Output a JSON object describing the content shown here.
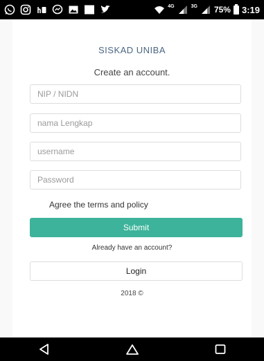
{
  "status_bar": {
    "network_4g": "4G",
    "network_3g": "3G",
    "battery": "75%",
    "time": "3:19",
    "icons": [
      "whatsapp-icon",
      "instagram-icon",
      "tiktok-icon",
      "messenger-icon",
      "gallery-icon",
      "blank-app-icon",
      "twitter-icon",
      "wifi-icon",
      "signal-icon",
      "battery-icon"
    ]
  },
  "app": {
    "title": "SISKAD UNIBA",
    "subtitle": "Create an account."
  },
  "form": {
    "nip_placeholder": "NIP / NIDN",
    "name_placeholder": "nama Lengkap",
    "username_placeholder": "username",
    "password_placeholder": "Password",
    "agree_text": "Agree the terms and policy",
    "submit_label": "Submit",
    "already_text": "Already have an account?",
    "login_label": "Login",
    "copyright": "2018 ©"
  },
  "colors": {
    "accent": "#3cb39a",
    "title": "#4b6682"
  }
}
